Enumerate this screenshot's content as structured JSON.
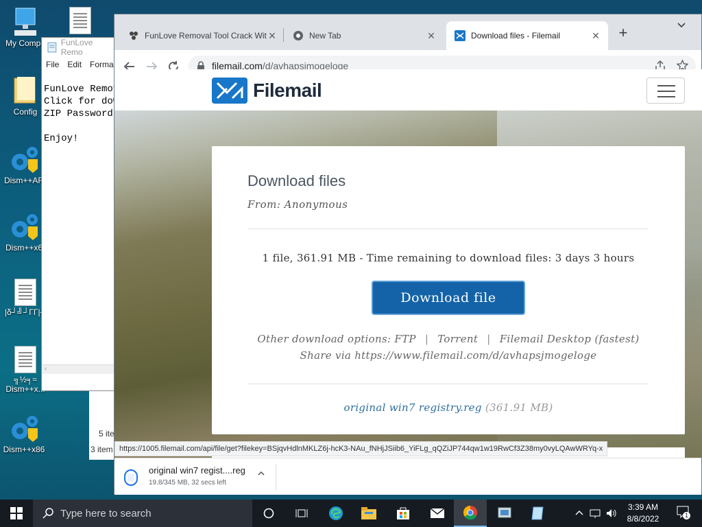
{
  "desktop": {
    "icons": [
      {
        "label": "My Compu",
        "icon": "computer-icon"
      },
      {
        "label": "",
        "icon": "document-icon"
      },
      {
        "label": "Config",
        "icon": "folder-icon"
      },
      {
        "label": "Dism++AR",
        "icon": "gear-icon"
      },
      {
        "label": "Dism++x6",
        "icon": "gear-icon"
      },
      {
        "label": "|δ┘╝┘ΓΓ|┘",
        "icon": "document-icon"
      },
      {
        "label": "╗½╕≈",
        "label2": "Dism++x...",
        "icon": "document-icon"
      },
      {
        "label": "Dism++x86",
        "icon": "gear-icon"
      }
    ]
  },
  "notepad": {
    "title": "FunLove Remo",
    "menu": [
      "File",
      "Edit",
      "Forma"
    ],
    "text": "FunLove Remov\nClick for dow\nZIP Password:\n\nEnjoy!"
  },
  "explorer": {
    "items_count": "5 ite",
    "items_count2": "3 item"
  },
  "browser": {
    "tabs": [
      {
        "title": "FunLove Removal Tool Crack Wit",
        "icon": "funlove-favicon",
        "active": false
      },
      {
        "title": "New Tab",
        "icon": "chrome-favicon",
        "active": false
      },
      {
        "title": "Download files - Filemail",
        "icon": "filemail-favicon",
        "active": true
      }
    ],
    "new_tab_label": "+",
    "url_host": "filemail.com",
    "url_path": "/d/avhapsjmogeloge",
    "status_url": "https://1005.filemail.com/api/file/get?filekey=BSjqvHdlnMKLZ6j-hcK3-NAu_fNHjJSiib6_YiFLg_qQZiJP744qw1w19RwCf3Z38my0vyLQAwWRYq-x"
  },
  "page": {
    "logo_text": "Filemail",
    "heading": "Download files",
    "from": "From: Anonymous",
    "summary": "1 file, 361.91 MB - Time remaining to download files: 3 days 3 hours",
    "download_button": "Download file",
    "options_prefix": "Other download options: FTP",
    "option_torrent": "Torrent",
    "option_desktop": "Filemail Desktop (fastest)",
    "option_sep": "|",
    "share": "Share via https://www.filemail.com/d/avhapsjmogeloge",
    "file_name": "original win7 registry.reg",
    "file_size": "(361.91 MB)"
  },
  "download": {
    "name": "original win7 regist....reg",
    "progress": "19.8/345 MB, 32 secs left"
  },
  "taskbar": {
    "search_placeholder": "Type here to search",
    "time": "3:39 AM",
    "date": "8/8/2022",
    "notification_count": "1"
  }
}
